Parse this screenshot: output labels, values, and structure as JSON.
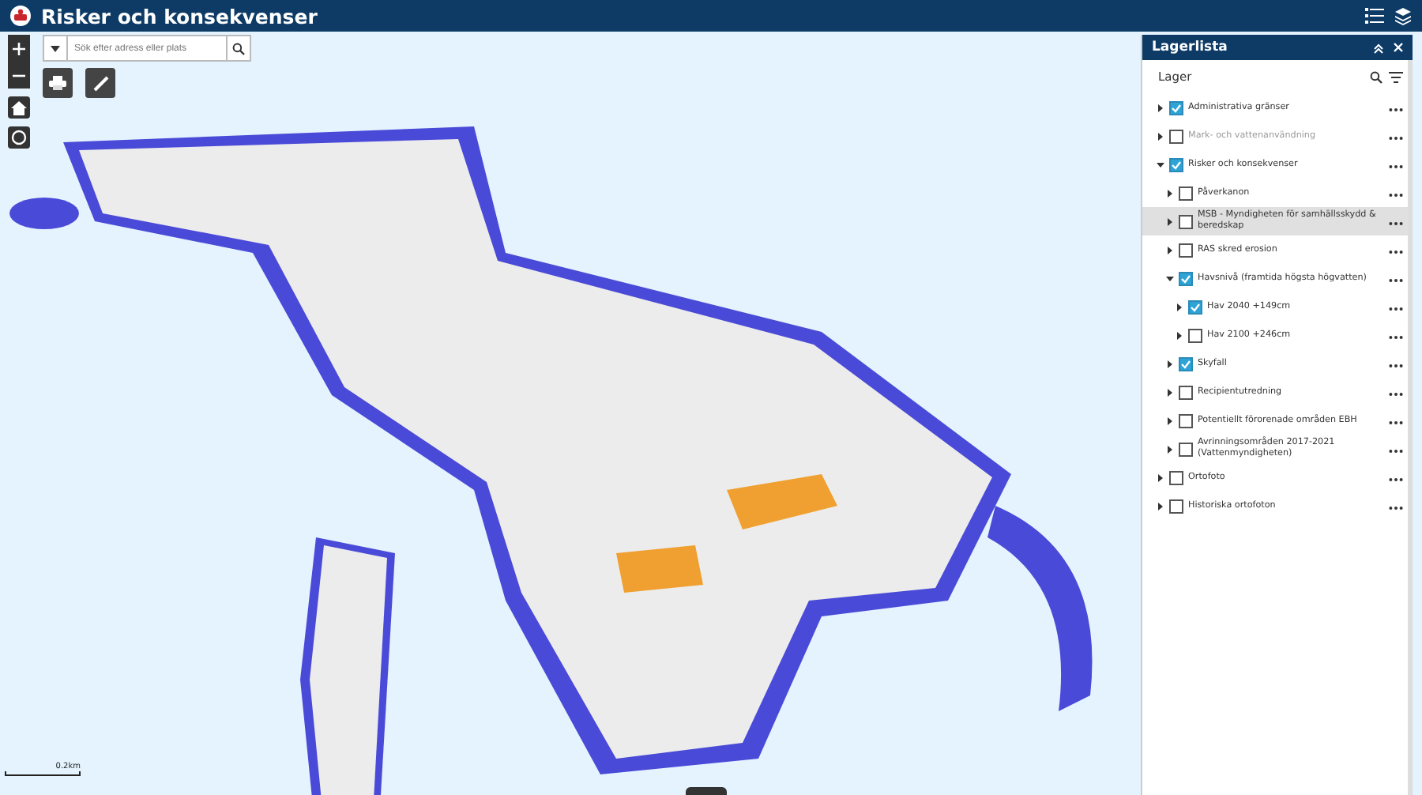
{
  "header": {
    "title": "Risker och konsekvenser"
  },
  "search": {
    "placeholder": "Sök efter adress eller plats"
  },
  "scale": {
    "label": "0.2km"
  },
  "layer_panel": {
    "title": "Lagerlista",
    "section": "Lager",
    "layers": [
      {
        "label": "Administrativa gränser",
        "checked": true,
        "expanded": false,
        "disabled": false,
        "selected": false
      },
      {
        "label": "Mark- och vattenanvändning",
        "checked": false,
        "expanded": false,
        "disabled": true,
        "selected": false
      },
      {
        "label": "Risker och konsekvenser",
        "checked": true,
        "expanded": true,
        "disabled": false,
        "selected": false,
        "children": [
          {
            "label": "Påverkanon",
            "checked": false,
            "expanded": false,
            "disabled": false,
            "selected": false
          },
          {
            "label": "MSB - Myndigheten för samhällsskydd & beredskap",
            "checked": false,
            "expanded": false,
            "disabled": false,
            "selected": true
          },
          {
            "label": "RAS skred erosion",
            "checked": false,
            "expanded": false,
            "disabled": false,
            "selected": false
          },
          {
            "label": "Havsnivå (framtida högsta högvatten)",
            "checked": true,
            "expanded": true,
            "disabled": false,
            "selected": false,
            "children": [
              {
                "label": "Hav 2040 +149cm",
                "checked": true,
                "expanded": false,
                "disabled": false,
                "selected": false
              },
              {
                "label": "Hav 2100 +246cm",
                "checked": false,
                "expanded": false,
                "disabled": false,
                "selected": false
              }
            ]
          },
          {
            "label": "Skyfall",
            "checked": true,
            "expanded": false,
            "disabled": false,
            "selected": false
          },
          {
            "label": "Recipientutredning",
            "checked": false,
            "expanded": false,
            "disabled": false,
            "selected": false
          },
          {
            "label": "Potentiellt förorenade områden EBH",
            "checked": false,
            "expanded": false,
            "disabled": false,
            "selected": false
          },
          {
            "label": "Avrinningsområden 2017-2021 (Vattenmyndigheten)",
            "checked": false,
            "expanded": false,
            "disabled": false,
            "selected": false
          }
        ]
      },
      {
        "label": "Ortofoto",
        "checked": false,
        "expanded": false,
        "disabled": false,
        "selected": false
      },
      {
        "label": "Historiska ortofoton",
        "checked": false,
        "expanded": false,
        "disabled": false,
        "selected": false
      }
    ]
  }
}
